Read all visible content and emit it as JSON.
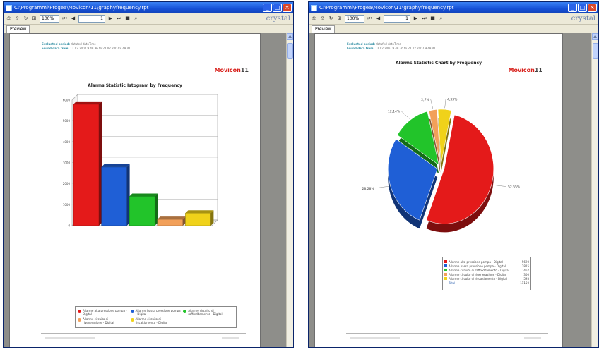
{
  "windows": [
    {
      "title": "C:\\Programmi\\Progea\\Movicon\\11\\graphyfrequency.rpt",
      "zoom": "100%",
      "page_current": "1",
      "page_total": "1",
      "brand": "crystal",
      "tab": "Preview",
      "report": {
        "header_line1_label": "Evaluated period:",
        "header_line1_value": "datafed datoTime",
        "header_line2_label": "Found data from:",
        "header_line2_value": "12.02.2007 9.48.36 to 27.02.2007 9.48.41",
        "logo": "Movicon",
        "logo_suffix": "11",
        "title": "Alarms Statistic Istogram by Frequency",
        "footer_left": "Movicon Report Frequency",
        "footer_right": "Page 1 of 1"
      }
    },
    {
      "title": "C:\\Programmi\\Progea\\Movicon\\11\\graphyfrequency.rpt",
      "zoom": "100%",
      "page_current": "1",
      "page_total": "1",
      "brand": "crystal",
      "tab": "Preview",
      "report": {
        "header_line1_label": "Evaluated period:",
        "header_line1_value": "datafed datoTime",
        "header_line2_label": "Found data from:",
        "header_line2_value": "12.02.2007 9.48.36 to 27.02.2007 9.48.41",
        "logo": "Movicon",
        "logo_suffix": "11",
        "title": "Alarms Statistic Chart by Frequency",
        "footer_left": "Movicon Report Frequency",
        "footer_right": "Page 1 of 1"
      }
    }
  ],
  "icons": [
    "window-icon",
    "print-icon",
    "export-icon",
    "refresh-icon",
    "first-page-icon",
    "prev-page-icon",
    "next-page-icon",
    "last-page-icon",
    "stop-icon",
    "search-binoculars-icon"
  ],
  "colors": {
    "red": "#e41a1a",
    "blue": "#1f5fd6",
    "green": "#22c42a",
    "orange": "#f2a05a",
    "yellow": "#f0d21a"
  },
  "chart_data": [
    {
      "type": "bar",
      "title": "Alarms Statistic Istogram by Frequency",
      "categories": [
        "Allarme alta pressione pompa - Digital",
        "Allarme bassa pressione pompa - Digital",
        "Allarme circuito di raffreddamento - Digital",
        "Allarme circuito di rigenerazione - Digital",
        "Allarme circuito di riscaldamento - Digital"
      ],
      "values": [
        5800,
        2800,
        1400,
        300,
        600
      ],
      "ylim": [
        0,
        6000
      ],
      "yticks": [
        "0",
        "1000",
        "2000",
        "3000",
        "4000",
        "5000",
        "6000"
      ],
      "grid": true,
      "legend": "bottom"
    },
    {
      "type": "pie",
      "title": "Alarms Statistic Chart by Frequency",
      "slices": [
        {
          "name": "Allarme alta pressione pompa - Digital",
          "value": 52.55,
          "label": "52,55%",
          "count": "5690"
        },
        {
          "name": "Allarme bassa pressione pompa - Digital",
          "value": 28.28,
          "label": "28,28%",
          "count": "2825"
        },
        {
          "name": "Allarme circuito di raffreddamento - Digital",
          "value": 12.14,
          "label": "12,14%",
          "count": "1462"
        },
        {
          "name": "Allarme circuito di rigenerazione - Digital",
          "value": 2.7,
          "label": "2,7%",
          "count": "300"
        },
        {
          "name": "Allarme circuito di riscaldamento - Digital",
          "value": 4.33,
          "label": "4,33%",
          "count": "593"
        }
      ],
      "total_label": "Total",
      "total_value": "11150",
      "legend": "bottom-right"
    }
  ]
}
